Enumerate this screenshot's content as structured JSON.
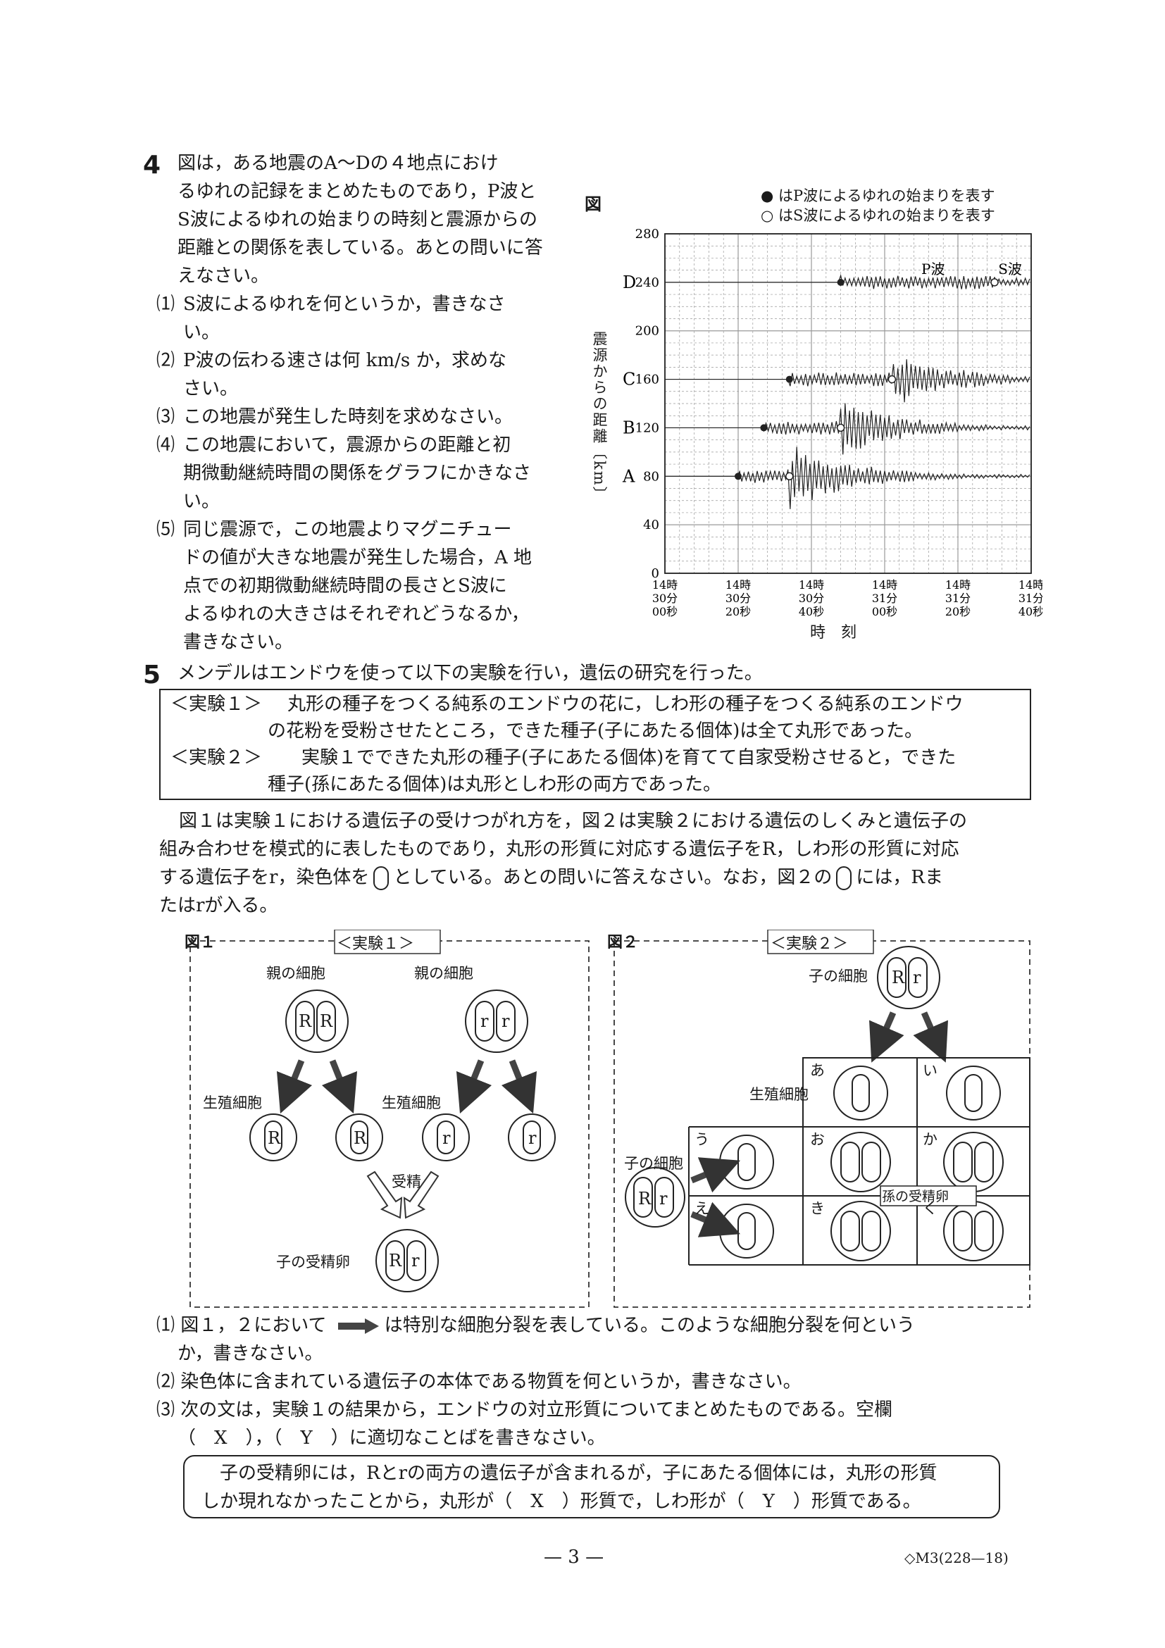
{
  "q4": {
    "num": "4",
    "intro": [
      "図は，ある地震のA〜Dの４地点におけ",
      "るゆれの記録をまとめたものであり，P波と",
      "S波によるゆれの始まりの時刻と震源からの",
      "距離との関係を表している。あとの問いに答",
      "えなさい。"
    ],
    "items": [
      {
        "n": "⑴",
        "lines": [
          "S波によるゆれを何というか，書きなさ",
          "い。"
        ]
      },
      {
        "n": "⑵",
        "lines": [
          "P波の伝わる速さは何 km/s か，求めな",
          "さい。"
        ]
      },
      {
        "n": "⑶",
        "lines": [
          "この地震が発生した時刻を求めなさい。"
        ]
      },
      {
        "n": "⑷",
        "lines": [
          "この地震において，震源からの距離と初",
          "期微動継続時間の関係をグラフにかきなさ",
          "い。"
        ]
      },
      {
        "n": "⑸",
        "lines": [
          "同じ震源で，この地震よりマグニチュー",
          "ドの値が大きな地震が発生した場合，A 地",
          "点での初期微動継続時間の長さとS波に",
          "よるゆれの大きさはそれぞれどうなるか，",
          "書きなさい。"
        ]
      }
    ],
    "figure": {
      "label": "図",
      "legend_p": "● はP波によるゆれの始まりを表す",
      "legend_s": "○ はS波によるゆれの始まりを表す",
      "ylabel": "震源からの距離〔km〕",
      "xlabel": "時　刻",
      "p_label": "P波",
      "s_label": "S波"
    }
  },
  "chart_data": {
    "type": "line",
    "xlabel": "時　刻",
    "ylabel": "震源からの距離〔km〕",
    "ylim": [
      0,
      280
    ],
    "yticks": [
      0,
      40,
      80,
      120,
      160,
      200,
      240,
      280
    ],
    "xlim_seconds_after_14_30": [
      0,
      100
    ],
    "xticks": [
      {
        "h": "14時",
        "m": "30分",
        "s": "00秒"
      },
      {
        "h": "14時",
        "m": "30分",
        "s": "20秒"
      },
      {
        "h": "14時",
        "m": "30分",
        "s": "40秒"
      },
      {
        "h": "14時",
        "m": "31分",
        "s": "00秒"
      },
      {
        "h": "14時",
        "m": "31分",
        "s": "20秒"
      },
      {
        "h": "14時",
        "m": "31分",
        "s": "40秒"
      }
    ],
    "grid": true,
    "stations": [
      {
        "name": "A",
        "distance": 80,
        "p_arrival_s": 20,
        "s_arrival_s": 34
      },
      {
        "name": "B",
        "distance": 120,
        "p_arrival_s": 27,
        "s_arrival_s": 48
      },
      {
        "name": "C",
        "distance": 160,
        "p_arrival_s": 34,
        "s_arrival_s": 62
      },
      {
        "name": "D",
        "distance": 240,
        "p_arrival_s": 48,
        "s_arrival_s": 90
      }
    ]
  },
  "q5": {
    "num": "5",
    "intro": "メンデルはエンドウを使って以下の実験を行い，遺伝の研究を行った。",
    "exp1_tag": "＜実験１＞",
    "exp1_l1": "丸形の種子をつくる純系のエンドウの花に，しわ形の種子をつくる純系のエンドウ",
    "exp1_l2": "の花粉を受粉させたところ，できた種子(子にあたる個体)は全て丸形であった。",
    "exp2_tag": "＜実験２＞",
    "exp2_l1": "実験１でできた丸形の種子(子にあたる個体)を育てて自家受粉させると，できた",
    "exp2_l2": "種子(孫にあたる個体)は丸形としわ形の両方であった。",
    "para_l1": "図１は実験１における遺伝子の受けつがれ方を，図２は実験２における遺伝のしくみと遺伝子の",
    "para_l2": "組み合わせを模式的に表したものであり，丸形の形質に対応する遺伝子をR，しわ形の形質に対応",
    "para_l3a": "する遺伝子をr，染色体を",
    "para_l3b": "としている。あとの問いに答えなさい。なお，図２の",
    "para_l3c": "には，Rま",
    "para_l4": "たはrが入る。",
    "fig1": {
      "label": "図１",
      "tag": "＜実験１＞",
      "parent": "親の細胞",
      "gamete": "生殖細胞",
      "fert": "受精",
      "child_egg": "子の受精卵",
      "RR": [
        "R",
        "R"
      ],
      "rr": [
        "r",
        "r"
      ],
      "gametes": [
        "R",
        "R",
        "r",
        "r"
      ],
      "child": [
        "R",
        "r"
      ]
    },
    "fig2": {
      "label": "図２",
      "tag": "＜実験２＞",
      "child_cell": "子の細胞",
      "gamete": "生殖細胞",
      "grand": "孫の受精卵",
      "child": [
        "R",
        "r"
      ],
      "cells": [
        "あ",
        "い",
        "う",
        "え",
        "お",
        "か",
        "き",
        "く"
      ]
    },
    "items": [
      {
        "n": "⑴",
        "a": "図１，２において",
        "b": "は特別な細胞分裂を表している。このような細胞分裂を何という",
        "c": "か，書きなさい。"
      },
      {
        "n": "⑵",
        "a": "染色体に含まれている遺伝子の本体である物質を何というか，書きなさい。"
      },
      {
        "n": "⑶",
        "a": "次の文は，実験１の結果から，エンドウの対立形質についてまとめたものである。空欄",
        "c": "（　X　），（　Y　）に適切なことばを書きなさい。"
      }
    ],
    "summary_l1": "子の受精卵には，Rとrの両方の遺伝子が含まれるが，子にあたる個体には，丸形の形質",
    "summary_l2": "しか現れなかったことから，丸形が（　X　）形質で，しわ形が（　Y　）形質である。"
  },
  "footer": {
    "page": "— 3 —",
    "code": "◇M3(228—18)"
  }
}
